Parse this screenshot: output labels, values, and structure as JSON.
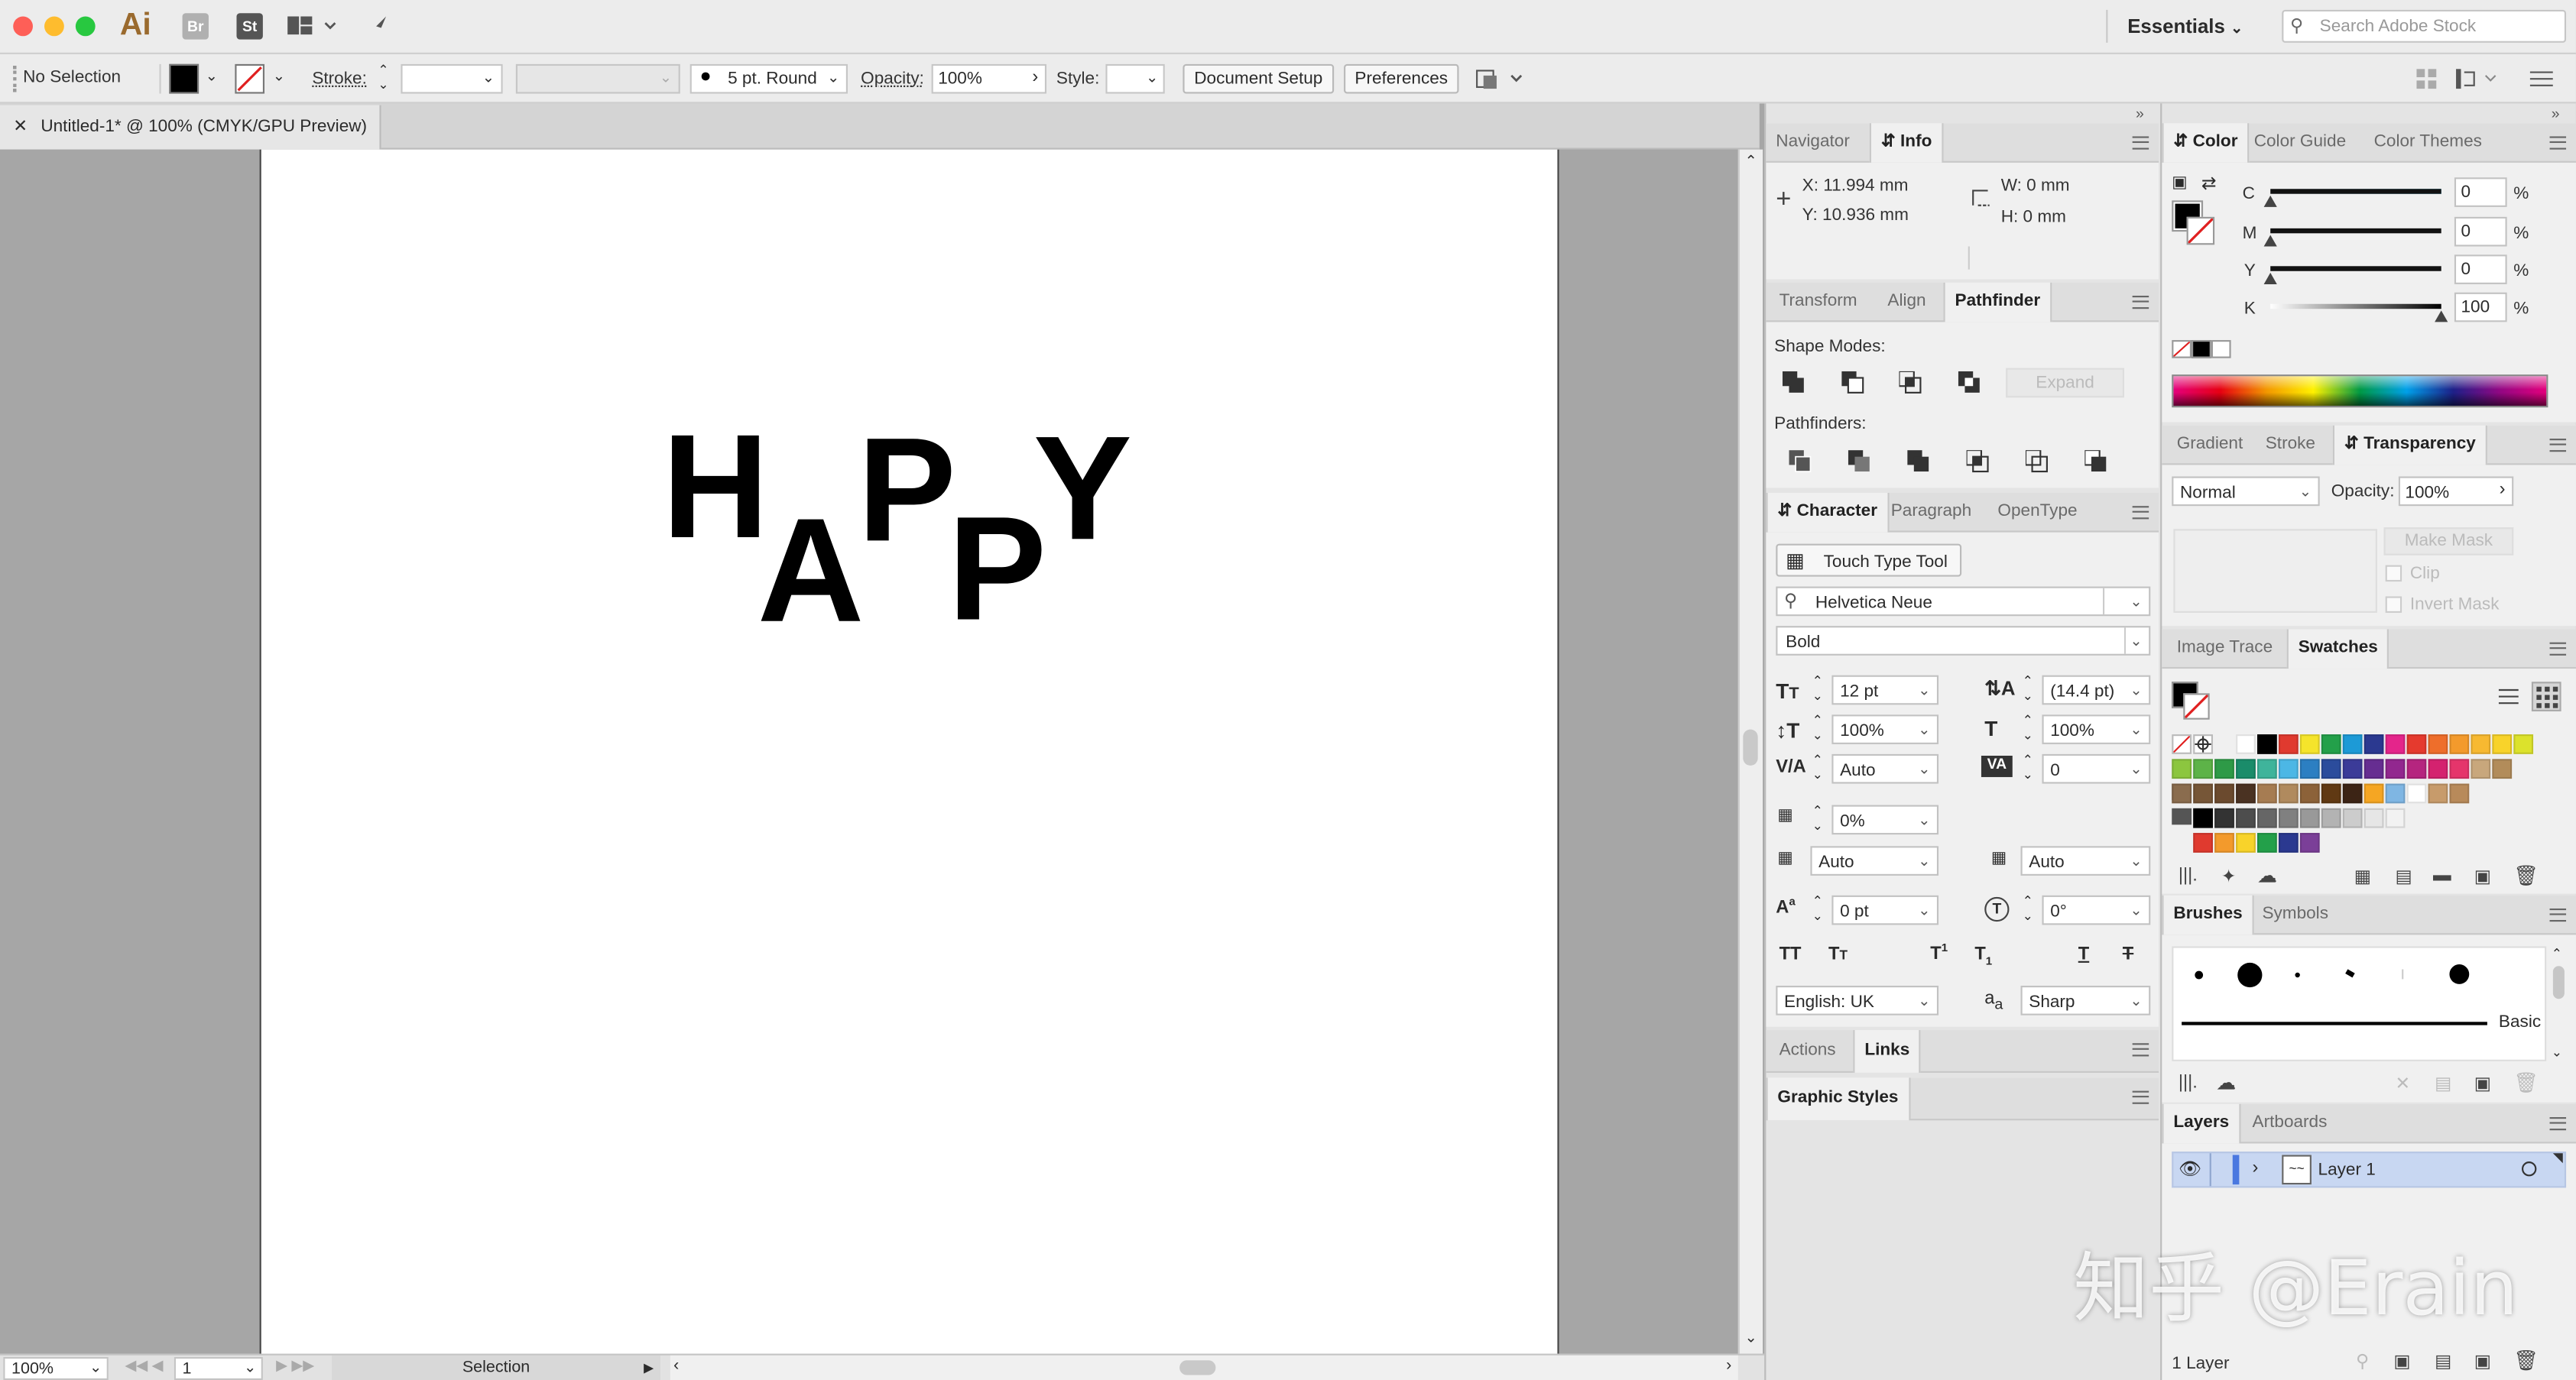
{
  "app": {
    "logo": "Ai",
    "bridge": "Br",
    "stock": "St",
    "workspace": "Essentials",
    "search_placeholder": "Search Adobe Stock"
  },
  "control": {
    "selection": "No Selection",
    "stroke_label": "Stroke:",
    "brush": "5 pt. Round",
    "opacity_label": "Opacity:",
    "opacity_value": "100%",
    "style_label": "Style:",
    "doc_setup": "Document Setup",
    "preferences": "Preferences"
  },
  "document": {
    "tab_title": "Untitled-1* @ 100% (CMYK/GPU Preview)",
    "letters": [
      "H",
      "A",
      "P",
      "P",
      "Y"
    ]
  },
  "status": {
    "zoom": "100%",
    "artboard": "1",
    "tool": "Selection"
  },
  "info_panel": {
    "tabs": [
      "Navigator",
      "Info"
    ],
    "x": "X:  11.994 mm",
    "y": "Y:  10.936 mm",
    "w": "W:  0 mm",
    "h": "H:  0 mm"
  },
  "pathfinder_panel": {
    "tabs": [
      "Transform",
      "Align",
      "Pathfinder"
    ],
    "shape_modes": "Shape Modes:",
    "expand": "Expand",
    "pathfinders": "Pathfinders:"
  },
  "character_panel": {
    "tabs": [
      "Character",
      "Paragraph",
      "OpenType"
    ],
    "touch_type": "Touch Type Tool",
    "font_family": "Helvetica Neue",
    "font_style": "Bold",
    "font_size": "12 pt",
    "leading": "(14.4 pt)",
    "vscale": "100%",
    "hscale": "100%",
    "kerning": "Auto",
    "tracking": "0",
    "tsume": "0%",
    "aki_left": "Auto",
    "aki_right": "Auto",
    "baseline": "0 pt",
    "rotation": "0°",
    "language": "English: UK",
    "antialias": "Sharp"
  },
  "actions_panel": {
    "tabs": [
      "Actions",
      "Links"
    ]
  },
  "graphic_styles": {
    "tabs": [
      "Graphic Styles"
    ]
  },
  "color_panel": {
    "tabs": [
      "Color",
      "Color Guide",
      "Color Themes"
    ],
    "channels": [
      {
        "label": "C",
        "value": "0"
      },
      {
        "label": "M",
        "value": "0"
      },
      {
        "label": "Y",
        "value": "0"
      },
      {
        "label": "K",
        "value": "100"
      }
    ],
    "unit": "%"
  },
  "transparency_panel": {
    "tabs": [
      "Gradient",
      "Stroke",
      "Transparency"
    ],
    "blend": "Normal",
    "opacity_label": "Opacity:",
    "opacity": "100%",
    "make_mask": "Make Mask",
    "clip": "Clip",
    "invert": "Invert Mask"
  },
  "swatches_panel": {
    "tabs": [
      "Image Trace",
      "Swatches"
    ],
    "row1": [
      "#ffffff",
      "#000000",
      "#e03a2f",
      "#f5e42b",
      "#23a04a",
      "#1d9ad6",
      "#2b3990",
      "#e4258b",
      "#e53a2e",
      "#ee6e2b",
      "#f39a2c",
      "#f7b931",
      "#f8d32a",
      "#dce22c"
    ],
    "row2": [
      "#8cc63f",
      "#5db348",
      "#2e9a47",
      "#1a8c6a",
      "#3fb49b",
      "#4cb7e5",
      "#2c7fc2",
      "#2b4c9c",
      "#3b3b98",
      "#662d91",
      "#92278f",
      "#b5257f",
      "#d4226f",
      "#e5356b",
      "#c8a77c",
      "#b28c5a"
    ],
    "row3": [
      "#8a6c4e",
      "#765637",
      "#6b4a2e",
      "#4a3222",
      "#a67c52",
      "#b08a5e",
      "#8c6239",
      "#603913",
      "#3c2415",
      "#f5a623",
      "#7fb6e3",
      "#ffffff",
      "#c79b6b",
      "#b88a5a"
    ],
    "row4": [
      "#000000",
      "#333333",
      "#4d4d4d",
      "#666666",
      "#808080",
      "#999999",
      "#b3b3b3",
      "#cccccc",
      "#e6e6e6",
      "#f2f2f2"
    ],
    "row5": [
      "#e03a2f",
      "#f39a2c",
      "#f8d32a",
      "#23a04a",
      "#2b3990",
      "#7b3f98"
    ]
  },
  "brushes_panel": {
    "tabs": [
      "Brushes",
      "Symbols"
    ],
    "basic": "Basic"
  },
  "layers_panel": {
    "tabs": [
      "Layers",
      "Artboards"
    ],
    "layer_name": "Layer 1",
    "footer": "1 Layer"
  },
  "watermark": "知乎 @Erain"
}
